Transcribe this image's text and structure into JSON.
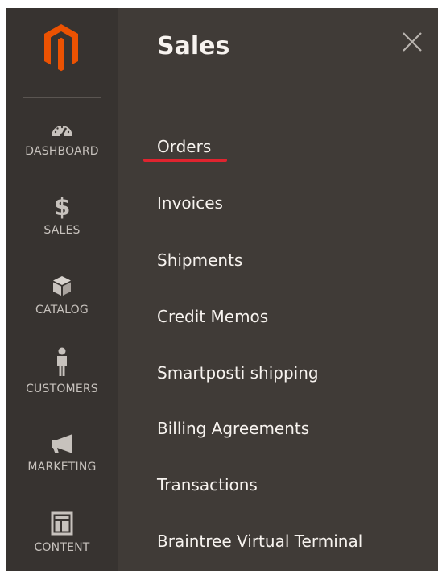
{
  "colors": {
    "panel_bg": "#403b37",
    "nav_bg": "#373330",
    "brand_orange": "#eb5202",
    "active_underline": "#e0242f",
    "text_light": "#f7f3ef",
    "nav_text": "#c7c2bd"
  },
  "nav": {
    "logo_icon": "magento-logo-icon",
    "items": [
      {
        "label": "DASHBOARD",
        "icon": "speedometer-icon"
      },
      {
        "label": "SALES",
        "icon": "dollar-icon"
      },
      {
        "label": "CATALOG",
        "icon": "box-icon"
      },
      {
        "label": "CUSTOMERS",
        "icon": "person-icon"
      },
      {
        "label": "MARKETING",
        "icon": "megaphone-icon"
      },
      {
        "label": "CONTENT",
        "icon": "layout-icon"
      }
    ]
  },
  "panel": {
    "title": "Sales",
    "close_icon": "close-icon",
    "active_item": "Orders",
    "items": [
      {
        "label": "Orders"
      },
      {
        "label": "Invoices"
      },
      {
        "label": "Shipments"
      },
      {
        "label": "Credit Memos"
      },
      {
        "label": "Smartposti shipping"
      },
      {
        "label": "Billing Agreements"
      },
      {
        "label": "Transactions"
      },
      {
        "label": "Braintree Virtual Terminal"
      }
    ]
  }
}
